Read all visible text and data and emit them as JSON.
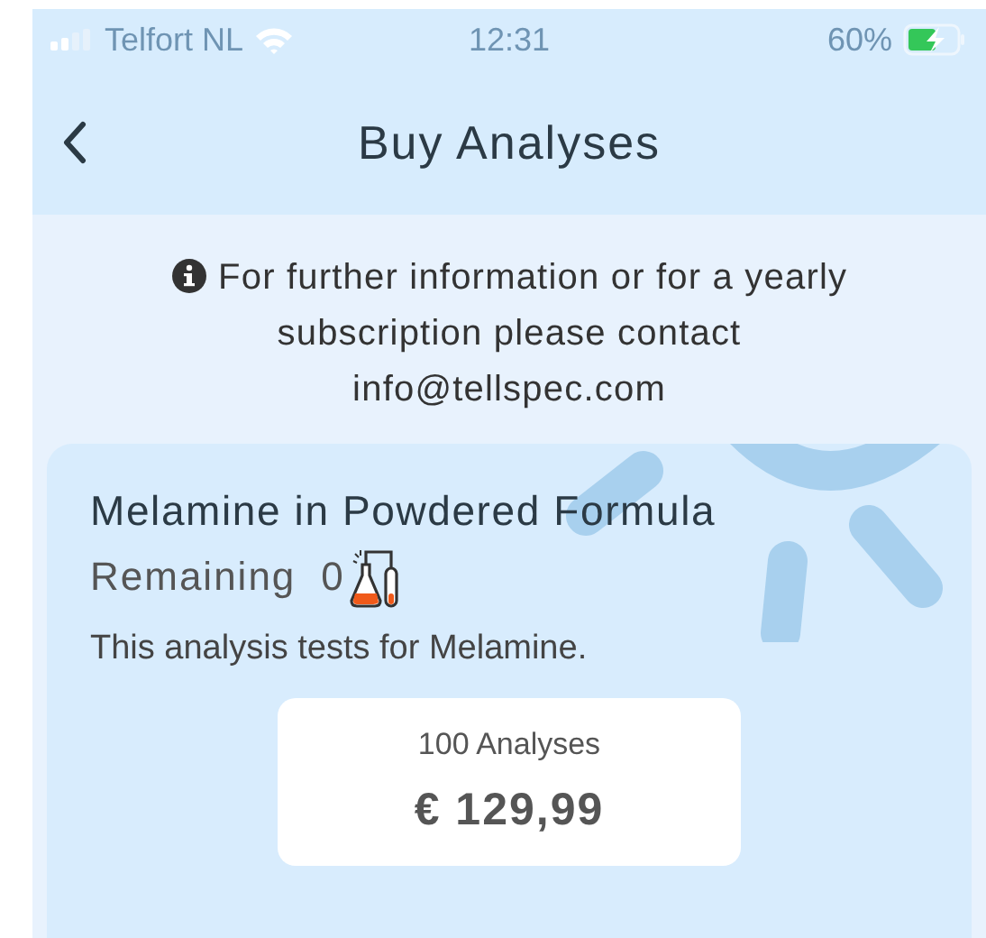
{
  "status_bar": {
    "carrier": "Telfort NL",
    "time": "12:31",
    "battery": "60%"
  },
  "nav": {
    "title": "Buy Analyses"
  },
  "info": {
    "text": "For further information or for a yearly subscription please contact info@tellspec.com"
  },
  "product": {
    "name": "Melamine in Powdered Formula",
    "remaining_label": "Remaining",
    "remaining": "0",
    "description": "This analysis tests for Melamine.",
    "packages": [
      {
        "quantity": "100 Analyses",
        "price": "€ 129,99"
      }
    ]
  }
}
